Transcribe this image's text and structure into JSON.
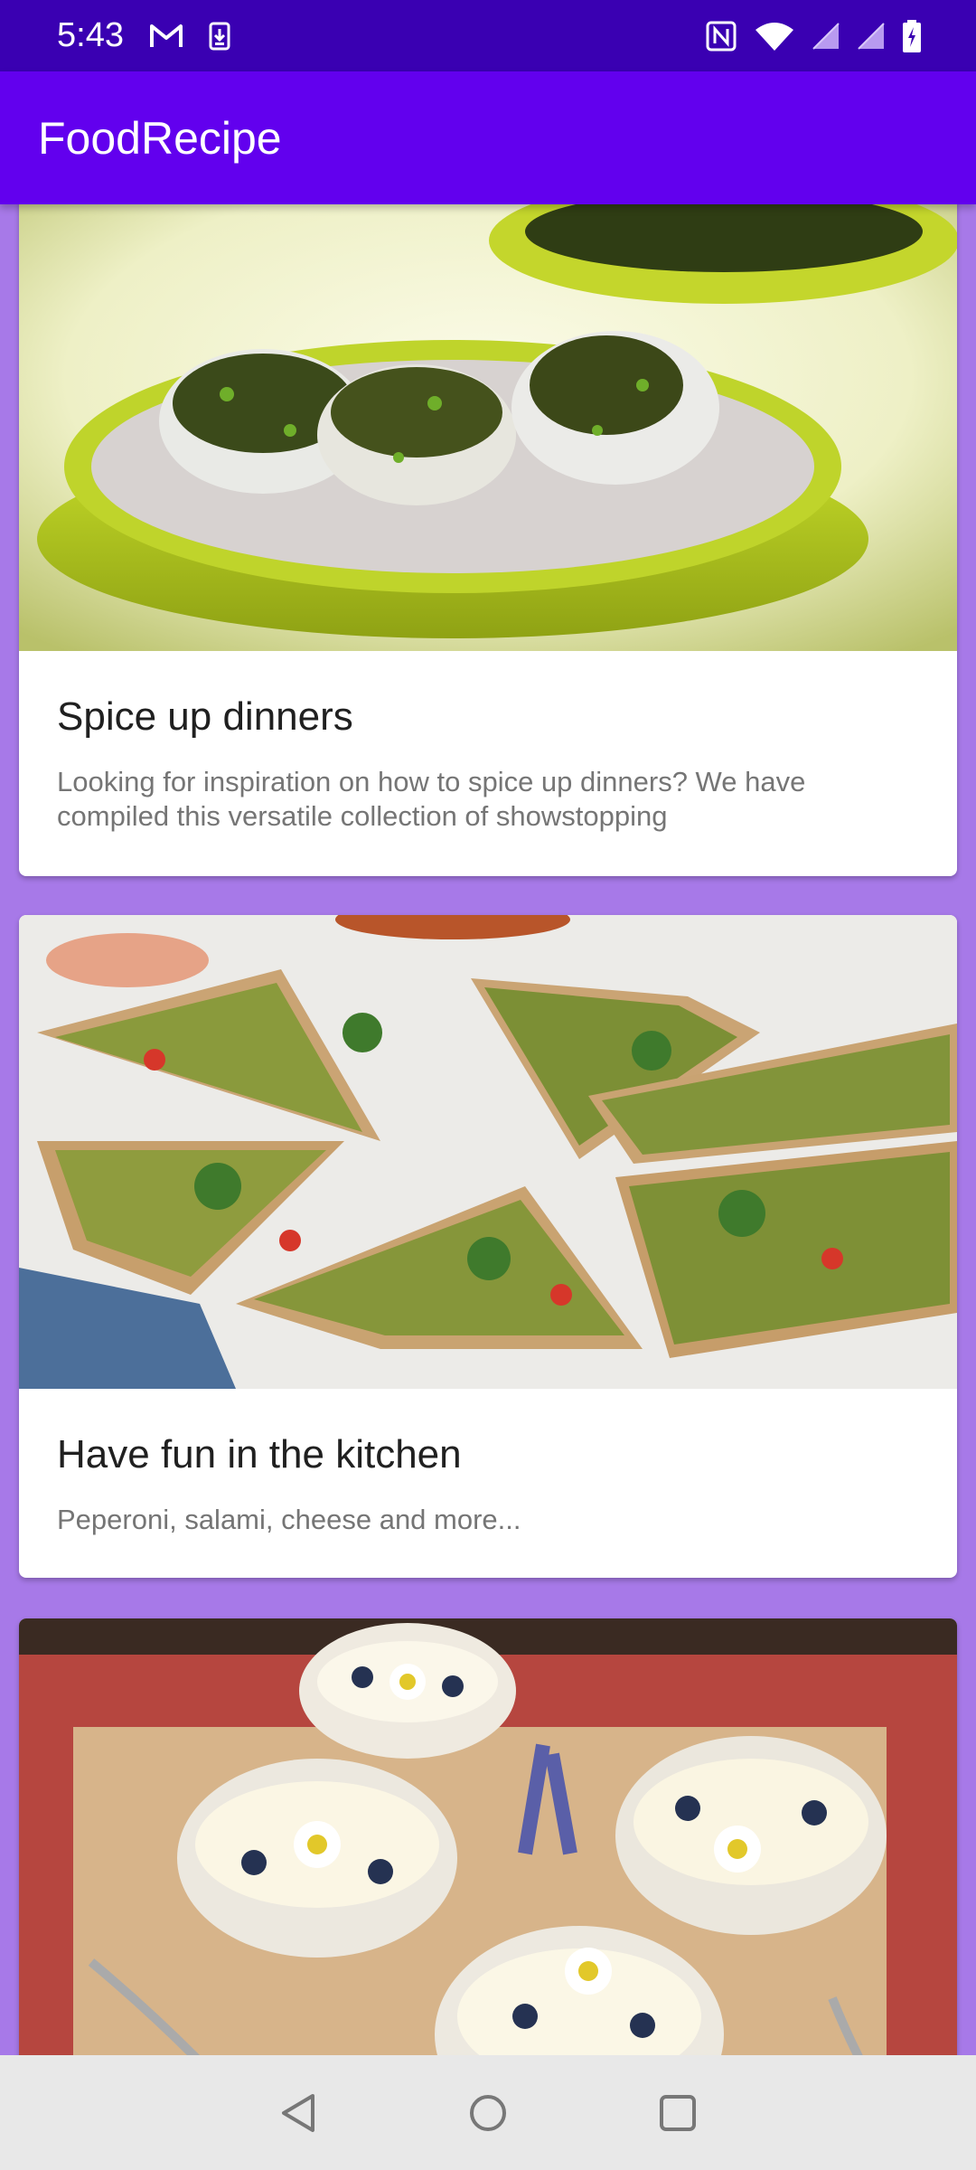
{
  "status_bar": {
    "time": "5:43",
    "left_icons": [
      "gmail-icon",
      "download-icon"
    ],
    "right_icons": [
      "nfc-icon",
      "wifi-icon",
      "signal-icon",
      "signal-icon",
      "battery-icon"
    ]
  },
  "app_bar": {
    "title": "FoodRecipe"
  },
  "cards": [
    {
      "image": "rice-balls-photo",
      "title": "Spice up dinners",
      "description": "Looking for inspiration on how to spice up dinners? We have compiled this versatile collection of showstopping"
    },
    {
      "image": "pizza-photo",
      "title": "Have fun in the kitchen",
      "description": "Peperoni, salami, cheese and more..."
    },
    {
      "image": "blueberry-dessert-photo",
      "title": "",
      "description": ""
    }
  ],
  "nav_bar": {
    "buttons": [
      "back-icon",
      "home-icon",
      "recents-icon"
    ]
  },
  "colors": {
    "status_bar": "#3a00b2",
    "app_bar": "#6200ee",
    "background": "#a779e8",
    "card": "#ffffff"
  }
}
